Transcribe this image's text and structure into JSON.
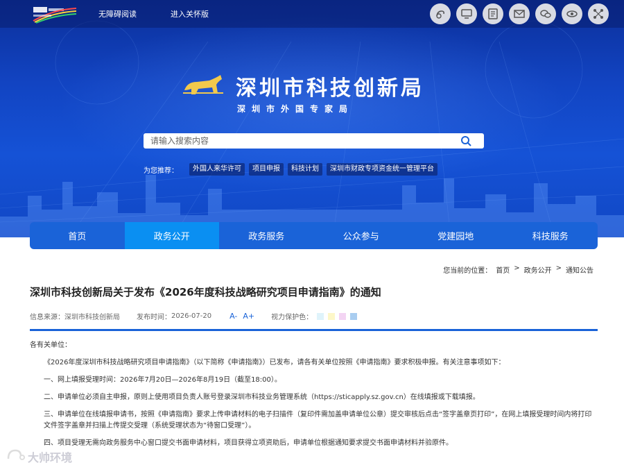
{
  "topbar": {
    "accessibility": "无障碍阅读",
    "care_mode": "进入关怀版",
    "icons": [
      "weibo-like-icon",
      "monitor-icon",
      "reader-icon",
      "mail-icon",
      "wechat-icon",
      "gov-service-icon",
      "network-icon"
    ]
  },
  "header": {
    "title": "深圳市科技创新局",
    "subtitle": "深圳市外国专家局"
  },
  "search": {
    "placeholder": "请输入搜索内容"
  },
  "recommend": {
    "label": "为您推荐：",
    "tags": [
      "外国人来华许可",
      "项目申报",
      "科技计划",
      "深圳市财政专项资金统一管理平台"
    ]
  },
  "nav": {
    "items": [
      "首页",
      "政务公开",
      "政务服务",
      "公众参与",
      "党建园地",
      "科技服务"
    ],
    "active": "政务公开"
  },
  "breadcrumb": {
    "prefix": "您当前的位置：",
    "items": [
      "首页",
      "政务公开",
      "通知公告"
    ],
    "sep": ">"
  },
  "article": {
    "title": "深圳市科技创新局关于发布《2026年度科技战略研究项目申请指南》的通知",
    "source_label": "信息来源：",
    "source": "深圳市科技创新局",
    "date_label": "发布时间：",
    "date": "2026-07-20",
    "font_smaller": "A-",
    "font_larger": "A+",
    "eye_label": "视力保护色：",
    "eye_colors": [
      "#dff3fb",
      "#fdf7c8",
      "#f3d4f3",
      "#a9cdf0"
    ],
    "salutation": "各有关单位：",
    "paragraphs": [
      "《2026年度深圳市科技战略研究项目申请指南》（以下简称《申请指南》）已发布，请各有关单位按照《申请指南》要求积极申报。有关注意事项如下：",
      "一、网上填报受理时间：2026年7月20日—2026年8月19日（截至18:00）。",
      "二、申请单位必须自主申报，原则上使用项目负责人账号登录深圳市科技业务管理系统（https://sticapply.sz.gov.cn）在线填报或下载填报。",
      "三、申请单位在线填报申请书，按照《申请指南》要求上传申请材料的电子扫描件（复印件需加盖申请单位公章）提交审核后点击“签字盖章页打印”，在网上填报受理时间内将打印文件签字盖章并扫描上传提交受理（系统受理状态为“待窗口受理”）。",
      "四、项目受理无需向政务服务中心窗口提交书面申请材料，项目获得立项资助后，申请单位根据通知要求提交书面申请材料并验原件。"
    ]
  },
  "watermark": {
    "text": "大帅环境"
  }
}
